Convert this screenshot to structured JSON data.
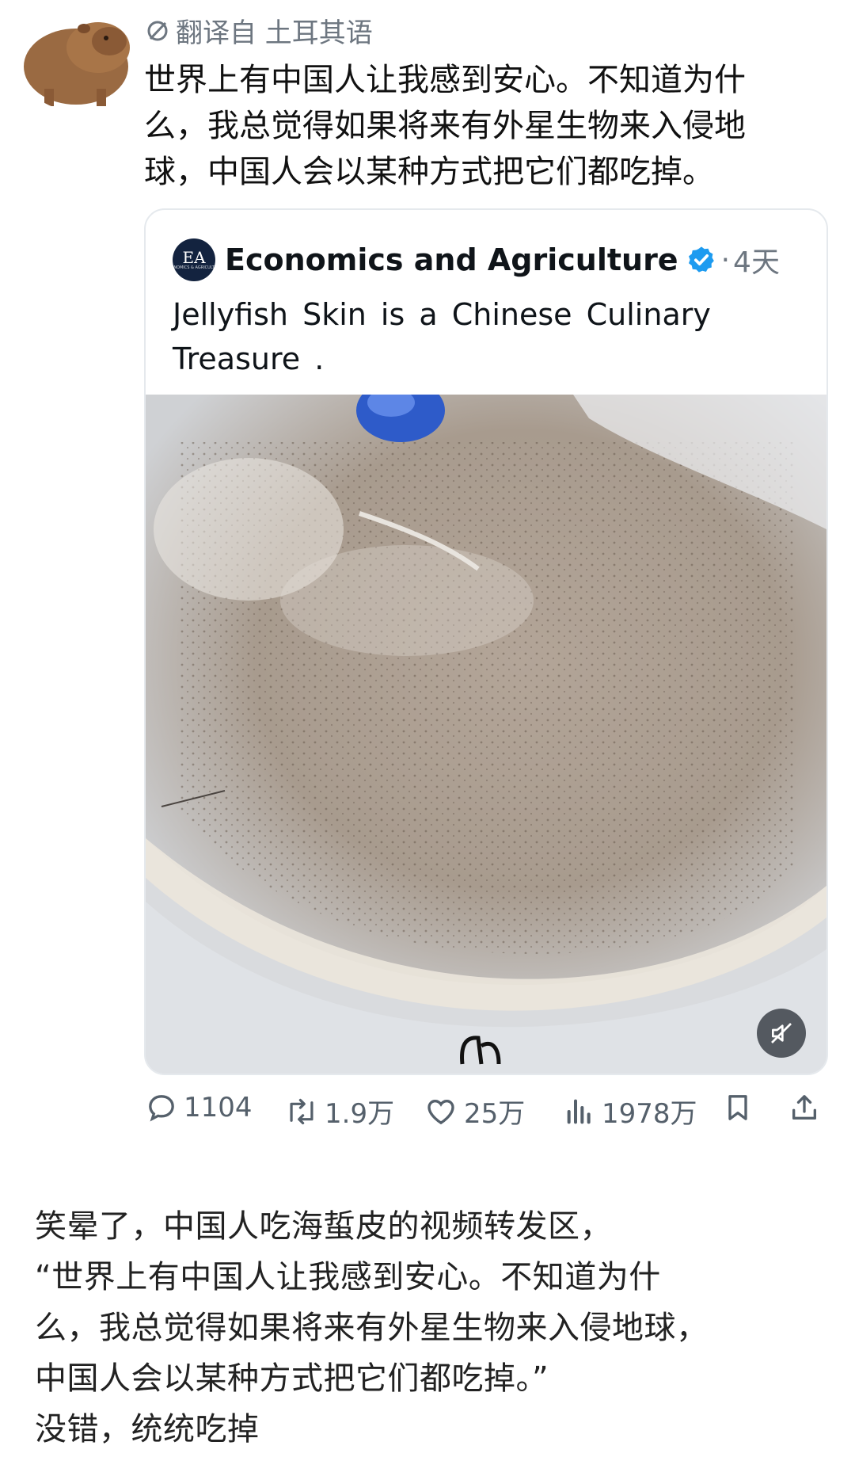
{
  "tweet": {
    "translated_label": "翻译自 土耳其语",
    "text_lines": [
      "世界上有中国人让我感到安心。不知道为什",
      "么，我总觉得如果将来有外星生物来入侵地",
      "球，中国人会以某种方式把它们都吃掉。"
    ]
  },
  "quote": {
    "logo_text": "EA",
    "logo_subtext": "ECONOMICS & AGRICULTURE",
    "name": "Economics and Agriculture",
    "dot": "·",
    "time": "4天",
    "text_lines": [
      "Jellyfish Skin is a Chinese Culinary",
      "Treasure ."
    ]
  },
  "actions": {
    "replies": "1104",
    "retweets": "1.9万",
    "likes": "25万",
    "views": "1978万"
  },
  "post": {
    "lines": [
      "笑晕了，中国人吃海蜇皮的视频转发区，",
      "“世界上有中国人让我感到安心。不知道为什",
      "么，我总觉得如果将来有外星生物来入侵地球，",
      "中国人会以某种方式把它们都吃掉。”",
      "没错，统统吃掉"
    ]
  },
  "colors": {
    "verified_blue": "#1d9bf0",
    "muted_text": "#6d7680",
    "action_gray": "#55606b"
  },
  "icons": [
    "capybara-avatar",
    "translate-icon",
    "verified-badge-icon",
    "mute-icon",
    "reply-icon",
    "retweet-icon",
    "like-icon",
    "views-icon",
    "bookmark-icon",
    "share-icon"
  ]
}
